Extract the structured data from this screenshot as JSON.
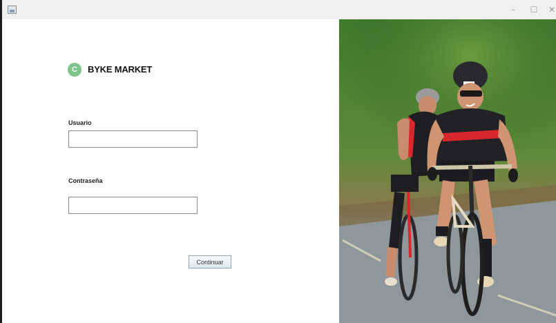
{
  "window": {
    "title": "",
    "controls": {
      "minimize": "–",
      "maximize": "☐",
      "close": "✕"
    }
  },
  "brand": {
    "mark": "C",
    "name": "BYKE MARKET",
    "mark_color": "#7fc28a"
  },
  "form": {
    "user_label": "Usuario",
    "user_value": "",
    "password_label": "Contraseña",
    "password_value": "",
    "submit_label": "Continuar"
  },
  "icons": {
    "app": "app-window-icon",
    "photo": "cyclists-photo"
  }
}
